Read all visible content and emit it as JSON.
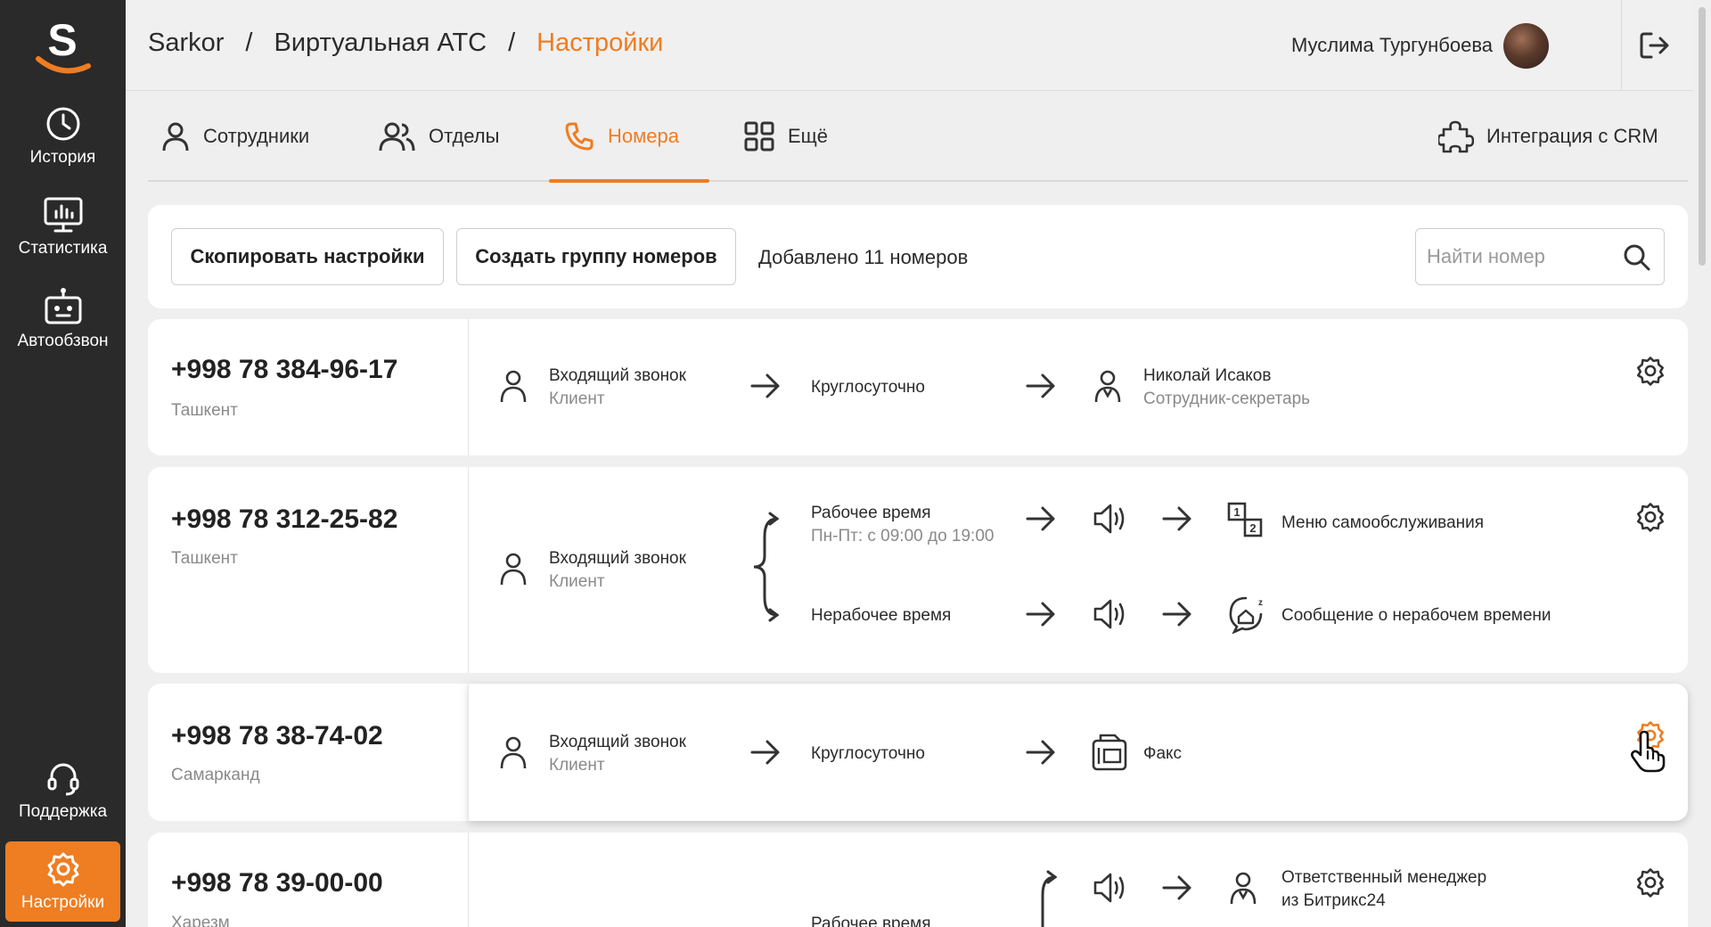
{
  "sidebar": {
    "logo_letter": "S",
    "items": [
      {
        "label": "История",
        "icon": "clock-icon"
      },
      {
        "label": "Статистика",
        "icon": "monitor-chart-icon"
      },
      {
        "label": "Автообзвон",
        "icon": "robot-icon"
      },
      {
        "label": "Поддержка",
        "icon": "headset-icon"
      },
      {
        "label": "Настройки",
        "icon": "gear-icon"
      }
    ],
    "active": "Настройки"
  },
  "header": {
    "breadcrumbs": [
      "Sarkor",
      "Виртуальная АТС",
      "Настройки"
    ],
    "separator": "/",
    "user_name": "Муслима Тургунбоева"
  },
  "tabs": [
    {
      "label": "Сотрудники",
      "icon": "user-icon"
    },
    {
      "label": "Отделы",
      "icon": "users-icon"
    },
    {
      "label": "Номера",
      "icon": "phone-icon",
      "active": true
    },
    {
      "label": "Ещё",
      "icon": "grid-icon"
    },
    {
      "label": "Интеграция с CRM",
      "icon": "puzzle-icon"
    }
  ],
  "toolbar": {
    "copy_label": "Скопировать настройки",
    "create_group_label": "Создать группу номеров",
    "count_text": "Добавлено 11 номеров",
    "search_placeholder": "Найти номер"
  },
  "numbers": [
    {
      "phone": "+998 78 384-96-17",
      "city": "Ташкент",
      "source": "Входящий звонок",
      "source_sub": "Клиент",
      "schedule": "Круглосуточно",
      "target": "Николай Исаков",
      "target_sub": "Сотрудник-секретарь"
    },
    {
      "phone": "+998 78 312-25-82",
      "city": "Ташкент",
      "source": "Входящий звонок",
      "source_sub": "Клиент",
      "branch1": "Рабочее время",
      "branch1_sub": "Пн-Пт: с 09:00 до 19:00",
      "target1": "Меню самообслуживания",
      "branch2": "Нерабочее время",
      "target2": "Сообщение о нерабочем времени"
    },
    {
      "phone": "+998 78 38-74-02",
      "city": "Самарканд",
      "source": "Входящий звонок",
      "source_sub": "Клиент",
      "schedule": "Круглосуточно",
      "target": "Факс"
    },
    {
      "phone": "+998 78 39-00-00",
      "city": "Харезм",
      "branch1": "Рабочее время",
      "target1_line1": "Ответственный менеджер",
      "target1_line2": "из Битрикс24"
    }
  ],
  "colors": {
    "accent": "#ef7d22",
    "sidebar_bg": "#2a2a2a",
    "page_bg": "#efefef"
  }
}
